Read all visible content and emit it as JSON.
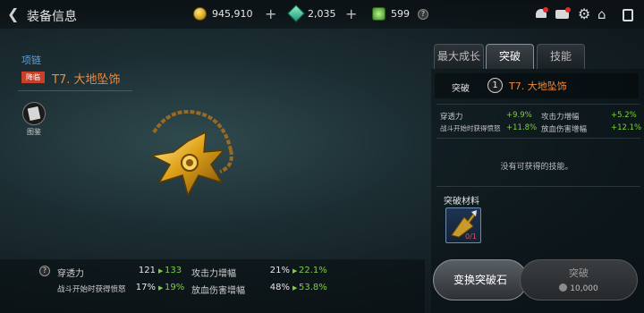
{
  "header": {
    "back_label": "装备信息",
    "gold": "945,910",
    "gems": "2,035",
    "crystals": "599",
    "help": "?"
  },
  "icons": [
    "back-icon",
    "gold-coin-icon",
    "gem-icon",
    "crystal-icon",
    "add-icon",
    "help-icon",
    "bell-icon",
    "mail-icon",
    "gear-icon",
    "home-icon",
    "phone-icon"
  ],
  "colors": {
    "item_name": "#f08a3c",
    "category": "#5ea0d8",
    "increase": "#7cd13c",
    "grade_badge": "#c6402a"
  },
  "item": {
    "category": "项链",
    "grade_badge": "降临",
    "name": "T7. 大地坠饰",
    "codex_label": "图鉴"
  },
  "stats": {
    "help": "?",
    "rows": [
      {
        "left_label": "穿透力",
        "left_cur": "121",
        "left_new": "133",
        "right_label": "攻击力增幅",
        "right_cur": "21%",
        "right_new": "22.1%"
      },
      {
        "left_label": "战斗开始时获得愤怒",
        "left_cur": "17%",
        "left_new": "19%",
        "right_label": "放血伤害增幅",
        "right_cur": "48%",
        "right_new": "53.8%"
      }
    ]
  },
  "tabs": [
    {
      "label": "最大成长"
    },
    {
      "label": "突破"
    },
    {
      "label": "技能"
    }
  ],
  "breakthrough": {
    "label": "突破",
    "level": "1",
    "name": "T7. 大地坠饰",
    "bonuses": [
      {
        "label": "穿透力",
        "value": "+9.9%"
      },
      {
        "label": "攻击力增幅",
        "value": "+5.2%"
      },
      {
        "label": "战斗开始时获得愤怒",
        "value": "+11.8%"
      },
      {
        "label": "放血伤害增幅",
        "value": "+12.1%"
      }
    ],
    "no_skill": "没有可获得的技能。",
    "materials_title": "突破材料",
    "material_count": "0/1"
  },
  "buttons": {
    "exchange": "变换突破石",
    "break": "突破",
    "break_cost": "10,000"
  }
}
